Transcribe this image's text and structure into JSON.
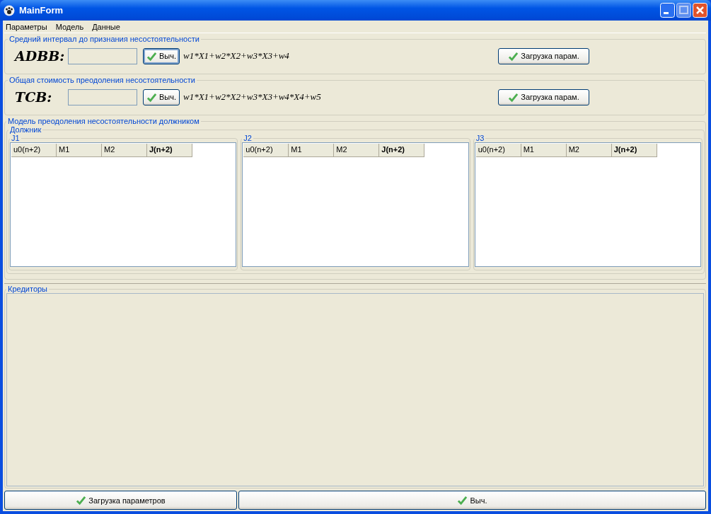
{
  "window": {
    "title": "MainForm"
  },
  "menu": [
    "Параметры",
    "Модель",
    "Данные"
  ],
  "formulas": [
    {
      "title": "Средний интервал до признания несостоятельности",
      "label": "ADBB:",
      "calc_button": "Выч.",
      "calc_focused": true,
      "formula": "w1*X1+w2*X2+w3*X3+w4",
      "load_button": "Загрузка парам."
    },
    {
      "title": "Общая стоимость преодоления несостоятельности",
      "label": "TCB:",
      "calc_button": "Выч.",
      "calc_focused": false,
      "formula": "w1*X1+w2*X2+w3*X3+w4*X4+w5",
      "load_button": "Загрузка парам."
    }
  ],
  "model": {
    "title": "Модель преодоления несостоятельности должником",
    "debtor": {
      "title": "Должник",
      "tables": [
        {
          "title": "J1",
          "columns": [
            {
              "label": "u0(n+2)",
              "bold": false
            },
            {
              "label": "M1",
              "bold": false
            },
            {
              "label": "M2",
              "bold": false
            },
            {
              "label": "J(n+2)",
              "bold": true
            }
          ]
        },
        {
          "title": "J2",
          "columns": [
            {
              "label": "u0(n+2)",
              "bold": false
            },
            {
              "label": "M1",
              "bold": false
            },
            {
              "label": "M2",
              "bold": false
            },
            {
              "label": "J(n+2)",
              "bold": true
            }
          ]
        },
        {
          "title": "J3",
          "columns": [
            {
              "label": "u0(n+2)",
              "bold": false
            },
            {
              "label": "M1",
              "bold": false
            },
            {
              "label": "M2",
              "bold": false
            },
            {
              "label": "J(n+2)",
              "bold": true
            }
          ]
        }
      ]
    }
  },
  "creditors": {
    "title": "Кредиторы"
  },
  "bottom_buttons": [
    "Загрузка параметров",
    "Выч."
  ]
}
